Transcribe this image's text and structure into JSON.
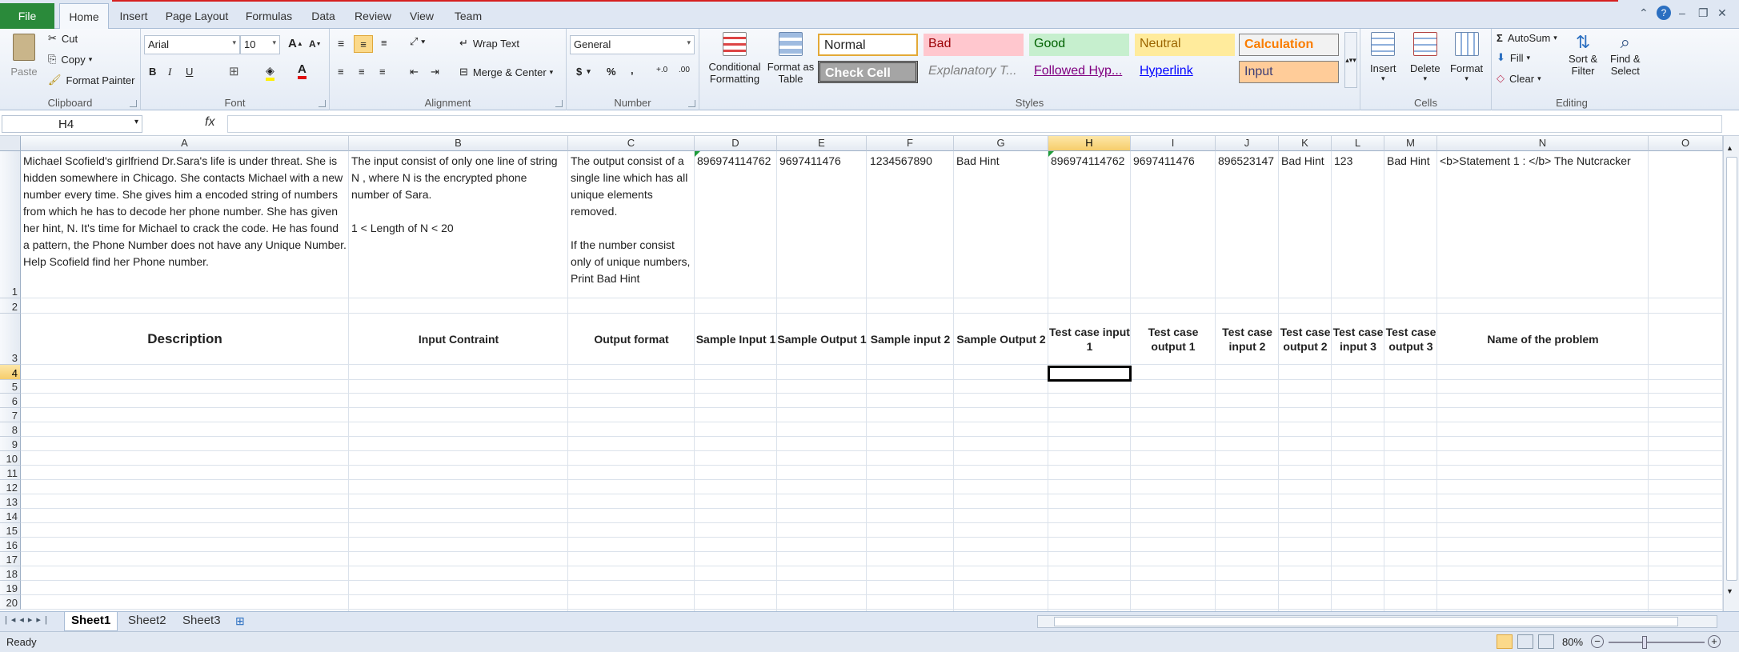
{
  "app": {
    "colors": {
      "file_tab": "#2a8a3a",
      "accent": "#d61f1f",
      "selected_header": "#f6cd6b"
    }
  },
  "tabs": {
    "file": "File",
    "home": "Home",
    "insert": "Insert",
    "page_layout": "Page Layout",
    "formulas": "Formulas",
    "data": "Data",
    "review": "Review",
    "view": "View",
    "team": "Team"
  },
  "clipboard": {
    "paste": "Paste",
    "cut": "Cut",
    "copy": "Copy",
    "format_painter": "Format Painter",
    "label": "Clipboard"
  },
  "font": {
    "name": "Arial",
    "size": "10",
    "bold": "B",
    "italic": "I",
    "underline": "U",
    "label": "Font"
  },
  "alignment": {
    "wrap_text": "Wrap Text",
    "merge_center": "Merge & Center",
    "label": "Alignment"
  },
  "number": {
    "format": "General",
    "currency": "$",
    "percent": "%",
    "comma": ",",
    "label": "Number"
  },
  "styles": {
    "conditional": "Conditional",
    "formatting": "Formatting",
    "format_as": "Format as",
    "table": "Table",
    "normal": "Normal",
    "bad": "Bad",
    "good": "Good",
    "neutral": "Neutral",
    "calculation": "Calculation",
    "check_cell": "Check Cell",
    "explanatory": "Explanatory T...",
    "followed": "Followed Hyp...",
    "hyperlink": "Hyperlink",
    "input": "Input",
    "label": "Styles"
  },
  "cells_grp": {
    "insert": "Insert",
    "delete": "Delete",
    "format": "Format",
    "label": "Cells"
  },
  "editing": {
    "autosum": "AutoSum",
    "fill": "Fill",
    "clear": "Clear",
    "sort1": "Sort &",
    "sort2": "Filter",
    "find1": "Find &",
    "find2": "Select",
    "label": "Editing"
  },
  "formula_bar": {
    "name_box": "H4",
    "fx": "fx",
    "content": ""
  },
  "columns": [
    "A",
    "B",
    "C",
    "D",
    "E",
    "F",
    "G",
    "H",
    "I",
    "J",
    "K",
    "L",
    "M",
    "N",
    "O"
  ],
  "rows": [
    "1",
    "2",
    "3",
    "4",
    "5",
    "6",
    "7",
    "8",
    "9",
    "10",
    "11",
    "12",
    "13",
    "14",
    "15",
    "16",
    "17",
    "18",
    "19",
    "20"
  ],
  "row1": {
    "a": "Michael Scofield's girlfriend Dr.Sara's life is under threat. She is hidden somewhere in Chicago. She contacts Michael with a new number every time. She gives him a encoded string of numbers from which he has to decode her phone number. She has given her hint, N. It's time for Michael to crack the code. He has found a pattern, the Phone Number does not have any Unique Number. Help Scofield find her Phone number.",
    "b1": "The input consist of only one line of string N , where N is the encrypted phone number of Sara.",
    "b2": "1 < Length of N < 20",
    "c1": "The output consist of a single line which has all unique elements removed.",
    "c2": "If the number consist only of unique numbers, Print Bad Hint",
    "d": "896974114762",
    "e": "9697411476",
    "f": "1234567890",
    "g": "Bad Hint",
    "h": "896974114762",
    "i": "9697411476",
    "j": "896523147",
    "k": "Bad Hint",
    "l": "123",
    "m": "Bad Hint",
    "n": "<b>Statement 1 : </b> The Nutcracker"
  },
  "row3": {
    "a": "Description",
    "b": "Input Contraint",
    "c": "Output format",
    "d": "Sample Input 1",
    "e": "Sample Output 1",
    "f": "Sample input 2",
    "g": "Sample Output 2",
    "h": "Test case input 1",
    "i": "Test case output 1",
    "j": "Test case input 2",
    "k": "Test case output 2",
    "l": "Test case input 3",
    "m": "Test case output 3",
    "n": "Name of the problem"
  },
  "sheets": [
    "Sheet1",
    "Sheet2",
    "Sheet3"
  ],
  "status": {
    "ready": "Ready",
    "zoom": "80%"
  }
}
